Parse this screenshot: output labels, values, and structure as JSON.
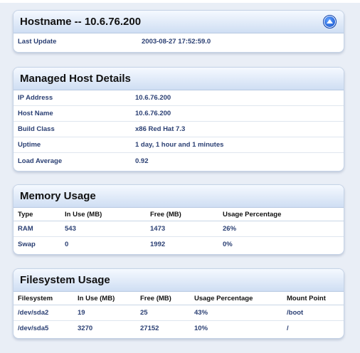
{
  "hostname_panel": {
    "title": "Hostname -- 10.6.76.200",
    "last_update_label": "Last Update",
    "last_update_value": "2003-08-27 17:52:59.0"
  },
  "managed_host": {
    "title": "Managed Host Details",
    "rows": [
      {
        "label": "IP Address",
        "value": "10.6.76.200"
      },
      {
        "label": "Host Name",
        "value": "10.6.76.200"
      },
      {
        "label": "Build Class",
        "value": "x86 Red Hat 7.3"
      },
      {
        "label": "Uptime",
        "value": "1 day, 1 hour and 1 minutes"
      },
      {
        "label": "Load Average",
        "value": "0.92"
      }
    ]
  },
  "memory": {
    "title": "Memory Usage",
    "columns": [
      "Type",
      "In Use (MB)",
      "Free (MB)",
      "Usage Percentage"
    ],
    "rows": [
      [
        "RAM",
        "543",
        "1473",
        "26%"
      ],
      [
        "Swap",
        "0",
        "1992",
        "0%"
      ]
    ]
  },
  "filesystem": {
    "title": "Filesystem Usage",
    "columns": [
      "Filesystem",
      "In Use (MB)",
      "Free (MB)",
      "Usage Percentage",
      "Mount Point"
    ],
    "rows": [
      [
        "/dev/sda2",
        "19",
        "25",
        "43%",
        "/boot"
      ],
      [
        "/dev/sda5",
        "3270",
        "27152",
        "10%",
        "/"
      ]
    ]
  },
  "icons": {
    "collapse": "collapse-up-icon"
  },
  "colors": {
    "header_gradient_top": "#f5f9ff",
    "header_gradient_bottom": "#cfdef3",
    "text_value": "#2a3f73",
    "collapse_button": "#0b48c4"
  }
}
